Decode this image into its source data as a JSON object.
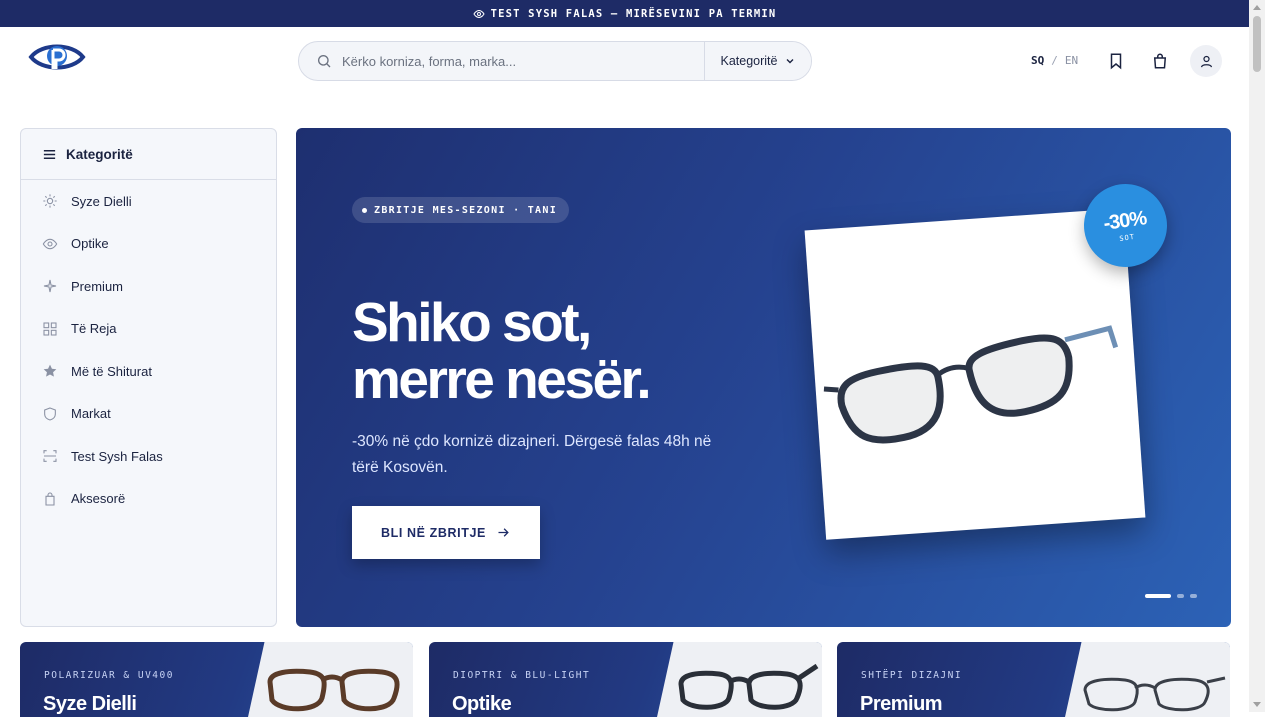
{
  "announcement": {
    "icon": "eye-icon",
    "text": "TEST SYSH FALAS — MIRËSEVINI PA TERMIN"
  },
  "header": {
    "logo": "eye-logo",
    "search": {
      "placeholder": "Kërko korniza, forma, marka...",
      "icon": "search-icon"
    },
    "category_select": {
      "label": "Kategoritë",
      "icon": "chevron-down-icon"
    },
    "language": {
      "active": "SQ",
      "separator": "/",
      "other": "EN"
    },
    "icons": [
      "bookmark-icon",
      "bag-icon",
      "user-icon"
    ]
  },
  "sidebar": {
    "title": "Kategoritë",
    "items": [
      {
        "label": "Syze Dielli",
        "icon": "sun-icon"
      },
      {
        "label": "Optike",
        "icon": "eye-icon"
      },
      {
        "label": "Premium",
        "icon": "sparkle-icon"
      },
      {
        "label": "Të Reja",
        "icon": "grid-icon"
      },
      {
        "label": "Më të Shiturat",
        "icon": "star-icon"
      },
      {
        "label": "Markat",
        "icon": "shield-icon"
      },
      {
        "label": "Test Sysh Falas",
        "icon": "scan-icon"
      },
      {
        "label": "Aksesorë",
        "icon": "bag-icon"
      }
    ]
  },
  "hero": {
    "badge": "ZBRITJE MES-SEZONI · TANI",
    "title_line1": "Shiko sot,",
    "title_line2": "merre nesër.",
    "subtitle": "-30% në çdo kornizë dizajneri. Dërgesë falas 48h në tërë Kosovën.",
    "cta": "BLI NË ZBRITJE",
    "discount": {
      "value": "-30%",
      "caption": "SOT"
    },
    "slides": {
      "count": 3,
      "active": 1
    },
    "colors": {
      "bg_start": "#1e2f70",
      "bg_end": "#2c62b6",
      "accent": "#2a8fe0"
    }
  },
  "category_cards": [
    {
      "kicker": "POLARIZUAR & UV400",
      "name": "Syze Dielli"
    },
    {
      "kicker": "DIOPTRI & BLU-LIGHT",
      "name": "Optike"
    },
    {
      "kicker": "SHTËPI DIZAJNI",
      "name": "Premium"
    }
  ]
}
